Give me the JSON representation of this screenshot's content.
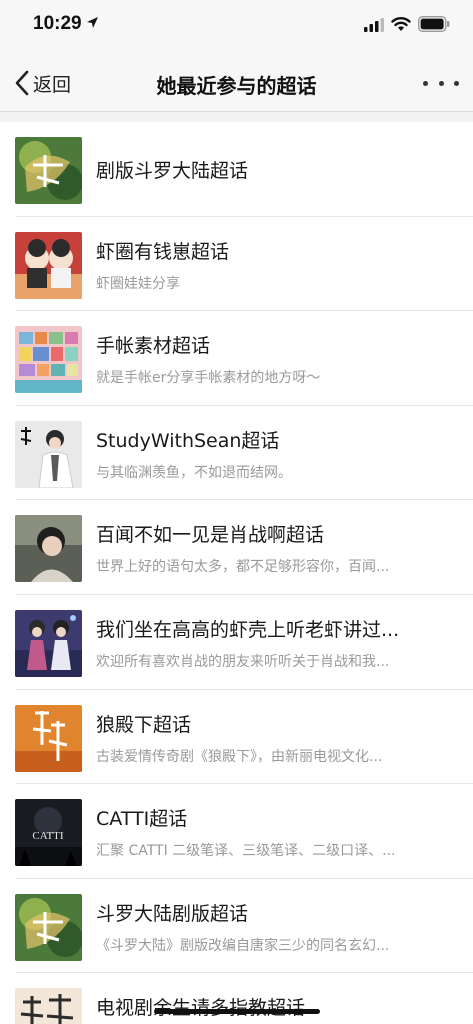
{
  "status_bar": {
    "time": "10:29",
    "icons": [
      "location-arrow-icon",
      "cellular-signal-icon",
      "wifi-icon",
      "battery-icon"
    ]
  },
  "nav": {
    "back_label": "返回",
    "title": "她最近参与的超话",
    "more_icon": "more-dots-icon"
  },
  "items": [
    {
      "title": "剧版斗罗大陆超话",
      "desc": ""
    },
    {
      "title": "虾圈有钱崽超话",
      "desc": "虾圈娃娃分享"
    },
    {
      "title": "手帐素材超话",
      "desc": "就是手帐er分享手帐素材的地方呀～"
    },
    {
      "title": "StudyWithSean超话",
      "desc": "与其临渊羡鱼，不如退而结网。"
    },
    {
      "title": "百闻不如一见是肖战啊超话",
      "desc": "世界上好的语句太多，都不足够形容你，百闻..."
    },
    {
      "title": "我们坐在高高的虾壳上听老虾讲过...",
      "desc": "欢迎所有喜欢肖战的朋友来听听关于肖战和我..."
    },
    {
      "title": "狼殿下超话",
      "desc": "古装爱情传奇剧《狼殿下》，由新丽电视文化..."
    },
    {
      "title": "CATTI超话",
      "desc": "汇聚 CATTI 二级笔译、三级笔译、二级口译、..."
    },
    {
      "title": "斗罗大陆剧版超话",
      "desc": "《斗罗大陆》剧版改编自唐家三少的同名玄幻..."
    },
    {
      "title": "电视剧余生请多指教超话",
      "desc": ""
    }
  ],
  "thumbnail_text": {
    "item_8": "CATTI"
  },
  "colors": {
    "background": "#f2f2f2",
    "list_bg": "#ffffff",
    "secondary_text": "#9a9a9a"
  }
}
